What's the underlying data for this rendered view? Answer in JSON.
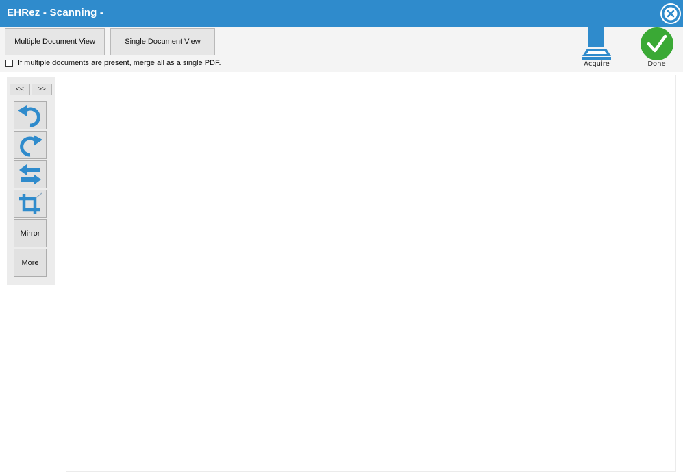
{
  "window": {
    "title": "EHRez - Scanning -"
  },
  "toolbar": {
    "multiple_view_label": "Multiple Document View",
    "single_view_label": "Single Document View",
    "merge_checkbox_label": "If multiple documents are present, merge all as a single PDF.",
    "merge_checked": false,
    "acquire_label": "Acquire",
    "done_label": "Done"
  },
  "side_panel": {
    "prev_label": "<<",
    "next_label": ">>",
    "tools": [
      {
        "icon": "rotate-left-icon"
      },
      {
        "icon": "rotate-right-icon"
      },
      {
        "icon": "flip-icon"
      },
      {
        "icon": "crop-icon"
      },
      {
        "label": "Mirror"
      },
      {
        "label": "More"
      }
    ]
  },
  "colors": {
    "titlebar": "#2f8bcc",
    "icon_blue": "#2f8bcc",
    "done_green": "#3aa935"
  }
}
